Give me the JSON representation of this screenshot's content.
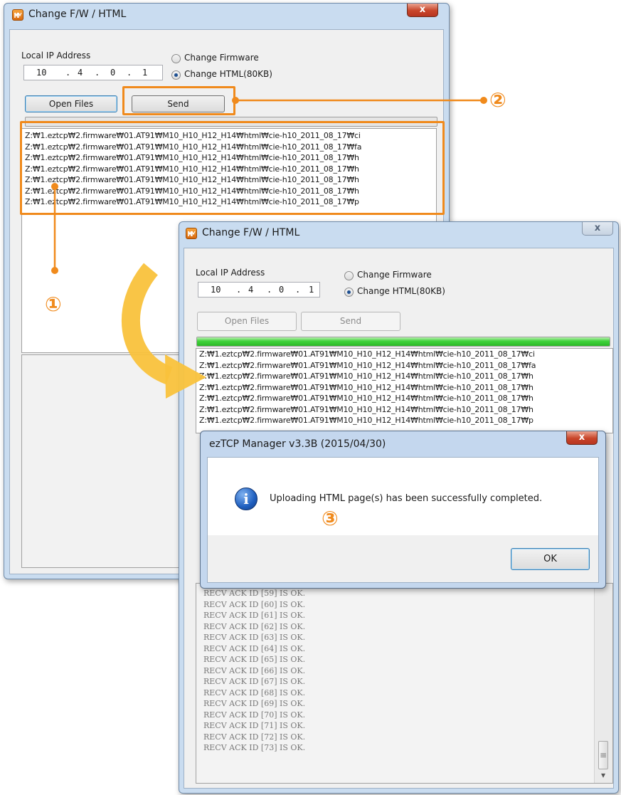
{
  "window1": {
    "title": "Change F/W / HTML",
    "close_label": "x",
    "local_ip_label": "Local IP Address",
    "ip_octets": [
      "10",
      "4",
      "0",
      "1"
    ],
    "radio_firmware": "Change Firmware",
    "radio_html": "Change HTML(80KB)",
    "selected_mode": "Change HTML(80KB)",
    "open_files_label": "Open Files",
    "send_label": "Send",
    "file_list": [
      "Z:₩1.eztcp₩2.firmware₩01.AT91₩M10_H10_H12_H14₩html₩cie-h10_2011_08_17₩ci",
      "Z:₩1.eztcp₩2.firmware₩01.AT91₩M10_H10_H12_H14₩html₩cie-h10_2011_08_17₩fa",
      "Z:₩1.eztcp₩2.firmware₩01.AT91₩M10_H10_H12_H14₩html₩cie-h10_2011_08_17₩h",
      "Z:₩1.eztcp₩2.firmware₩01.AT91₩M10_H10_H12_H14₩html₩cie-h10_2011_08_17₩h",
      "Z:₩1.eztcp₩2.firmware₩01.AT91₩M10_H10_H12_H14₩html₩cie-h10_2011_08_17₩h",
      "Z:₩1.eztcp₩2.firmware₩01.AT91₩M10_H10_H12_H14₩html₩cie-h10_2011_08_17₩h",
      "Z:₩1.eztcp₩2.firmware₩01.AT91₩M10_H10_H12_H14₩html₩cie-h10_2011_08_17₩p"
    ]
  },
  "window2": {
    "title": "Change F/W / HTML",
    "close_label": "x",
    "local_ip_label": "Local IP Address",
    "ip_octets": [
      "10",
      "4",
      "0",
      "1"
    ],
    "radio_firmware": "Change Firmware",
    "radio_html": "Change HTML(80KB)",
    "selected_mode": "Change HTML(80KB)",
    "open_files_label": "Open Files",
    "send_label": "Send",
    "progress_fraction": 1.0,
    "file_list": [
      "Z:₩1.eztcp₩2.firmware₩01.AT91₩M10_H10_H12_H14₩html₩cie-h10_2011_08_17₩ci",
      "Z:₩1.eztcp₩2.firmware₩01.AT91₩M10_H10_H12_H14₩html₩cie-h10_2011_08_17₩fa",
      "Z:₩1.eztcp₩2.firmware₩01.AT91₩M10_H10_H12_H14₩html₩cie-h10_2011_08_17₩h",
      "Z:₩1.eztcp₩2.firmware₩01.AT91₩M10_H10_H12_H14₩html₩cie-h10_2011_08_17₩h",
      "Z:₩1.eztcp₩2.firmware₩01.AT91₩M10_H10_H12_H14₩html₩cie-h10_2011_08_17₩h",
      "Z:₩1.eztcp₩2.firmware₩01.AT91₩M10_H10_H12_H14₩html₩cie-h10_2011_08_17₩h",
      "Z:₩1.eztcp₩2.firmware₩01.AT91₩M10_H10_H12_H14₩html₩cie-h10_2011_08_17₩p"
    ],
    "log_lines": [
      "RECV ACK ID [59] IS OK.",
      "RECV ACK ID [60] IS OK.",
      "RECV ACK ID [61] IS OK.",
      "RECV ACK ID [62] IS OK.",
      "RECV ACK ID [63] IS OK.",
      "RECV ACK ID [64] IS OK.",
      "RECV ACK ID [65] IS OK.",
      "RECV ACK ID [66] IS OK.",
      "RECV ACK ID [67] IS OK.",
      "RECV ACK ID [68] IS OK.",
      "RECV ACK ID [69] IS OK.",
      "RECV ACK ID [70] IS OK.",
      "RECV ACK ID [71] IS OK.",
      "RECV ACK ID [72] IS OK.",
      "RECV ACK ID [73] IS OK."
    ],
    "scroll_grip": "≡",
    "scroll_down": "▾"
  },
  "dialog": {
    "title": "ezTCP Manager v3.3B (2015/04/30)",
    "close_label": "x",
    "info_icon": "i",
    "message": "Uploading HTML page(s) has been successfully completed.",
    "ok_label": "OK"
  },
  "callouts": {
    "one": "①",
    "two": "②",
    "three": "③"
  },
  "colors": {
    "accent_orange": "#f08a1c",
    "arrow_yellow": "#f9c23c",
    "progress_green": "#3fd23a",
    "info_blue": "#1f5fbf"
  }
}
